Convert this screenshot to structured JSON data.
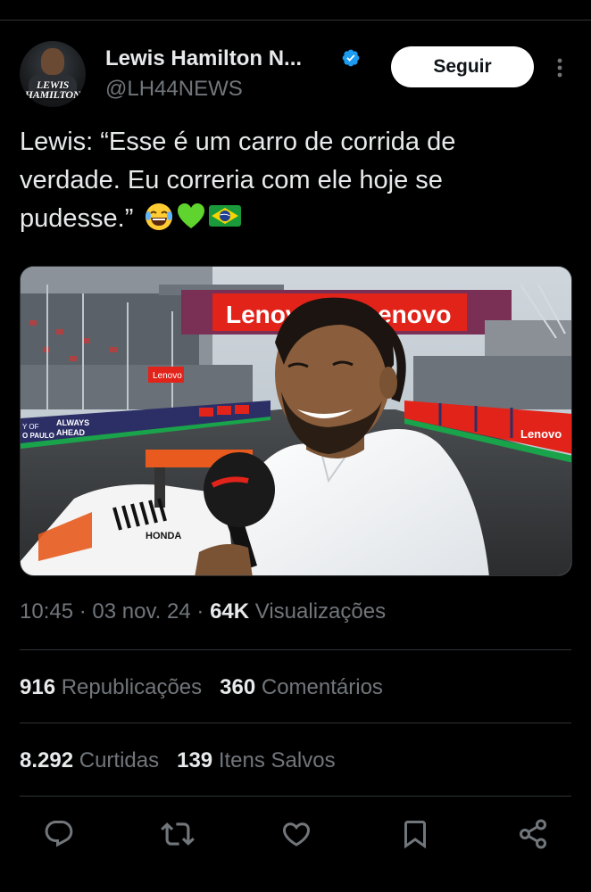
{
  "account": {
    "name": "Lewis Hamilton N...",
    "handle": "@LH44NEWS",
    "avatar_logo": "LEWIS HAMILTON",
    "verified": true,
    "follow_label": "Seguir"
  },
  "tweet": {
    "text_line1": "Lewis: “Esse é um carro de corrida de",
    "text_line2": "verdade. Eu correria com ele hoje se",
    "text_line3": "pudesse.”",
    "emojis": [
      "😂",
      "💚",
      "🇧🇷"
    ]
  },
  "media": {
    "banner_text": "Lenovo",
    "banner_right_text": "enovo",
    "sign_small": "Lenovo",
    "board_left_1": "Y OF",
    "board_left_2": "O PAULO",
    "board_left_3": "ALWAYS",
    "board_left_4": "AHEAD",
    "board_right_1": "Lenovo",
    "car_brand": "HONDA"
  },
  "meta": {
    "time": "10:45",
    "date": "03 nov. 24",
    "views_count": "64K",
    "views_label": "Visualizações",
    "separator": "·"
  },
  "stats": {
    "reposts_count": "916",
    "reposts_label": "Republicações",
    "comments_count": "360",
    "comments_label": "Comentários",
    "likes_count": "8.292",
    "likes_label": "Curtidas",
    "saves_count": "139",
    "saves_label": "Itens Salvos"
  },
  "icons": {
    "reply": "reply-icon",
    "repost": "repost-icon",
    "like": "like-icon",
    "bookmark": "bookmark-icon",
    "share": "share-icon"
  },
  "colors": {
    "background": "#000000",
    "text": "#e7e9ea",
    "muted": "#71767b",
    "verified": "#1d9bf0",
    "divider": "#2f3336"
  }
}
